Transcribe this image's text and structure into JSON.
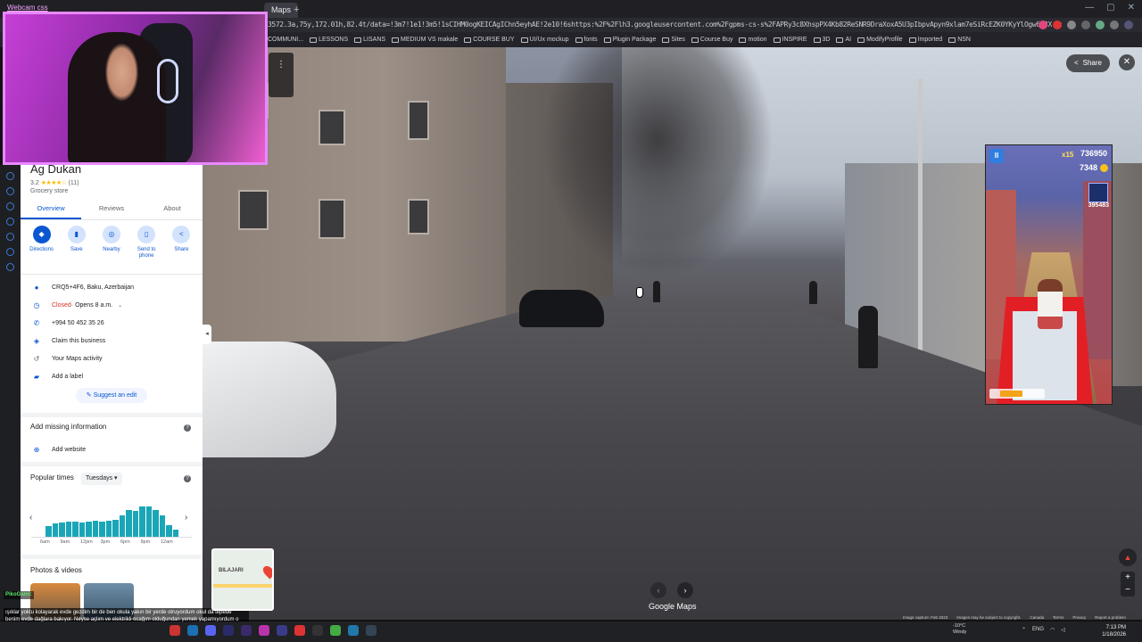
{
  "browser": {
    "tab_title": "Maps",
    "new_tab": "+",
    "window_controls": [
      "—",
      "▢",
      "✕"
    ],
    "url": "3572.3a,75y,172.01h,82.4t/data=!3m7!1e1!3m5!1sCIHM0ogKEICAgIChn5eyhAE!2e10!6shttps:%2F%2Flh3.googleusercontent.com%2Fgpms-cs-s%2FAPRy3c8XhspPX4Kb82ReSNR9DraXoxA5U3pIbpvApyn9xlam7eSiRcEZK0YKyYlOgw613X-yeMFKdW5xuyI0lFvkpnaLZ7QpQ2J1gMc6mN6",
    "bookmarks": [
      "COMMUNI...",
      "LESSONS",
      "LISANS",
      "MEDIUM VS makale",
      "COURSE BUY",
      "UI/Ux mockup",
      "fonts",
      "Plugin Package",
      "Sites",
      "Course Buy",
      "motion",
      "INSPIRE",
      "3D",
      "AI",
      "ModifyProfile",
      "Imported",
      "NSN"
    ]
  },
  "webcam": {
    "label": "Webcam css"
  },
  "place": {
    "name": "Ag Dukan",
    "rating": "3.2",
    "stars": "★★★★☆",
    "review_count": "(11)",
    "category": "Grocery store",
    "tabs": [
      "Overview",
      "Reviews",
      "About"
    ],
    "actions": [
      {
        "label": "Directions",
        "icon": "◆"
      },
      {
        "label": "Save",
        "icon": "▮"
      },
      {
        "label": "Nearby",
        "icon": "◎"
      },
      {
        "label": "Send to phone",
        "icon": "▯"
      },
      {
        "label": "Share",
        "icon": "<"
      }
    ],
    "address": "CRQ5+4F6, Baku, Azerbaijan",
    "status_closed": "Closed",
    "status_opens": " · Opens 8 a.m.",
    "phone": "+994 50 452 35 26",
    "claim": "Claim this business",
    "maps_activity": "Your Maps activity",
    "add_label": "Add a label",
    "suggest_edit": "Suggest an edit",
    "missing_title": "Add missing information",
    "add_website": "Add website",
    "popular_title": "Popular times",
    "popular_day": "Tuesdays",
    "hour_labels": [
      "6am",
      "9am",
      "12pm",
      "3pm",
      "6pm",
      "9pm",
      "12am"
    ],
    "photos_title": "Photos & videos"
  },
  "chart_data": {
    "type": "bar",
    "title": "Popular times",
    "categories": [
      "6am",
      "7am",
      "8am",
      "9am",
      "10am",
      "11am",
      "12pm",
      "1pm",
      "2pm",
      "3pm",
      "4pm",
      "5pm",
      "6pm",
      "7pm",
      "8pm",
      "9pm",
      "10pm",
      "11pm",
      "12am",
      "1am"
    ],
    "values": [
      28,
      35,
      38,
      40,
      40,
      38,
      40,
      43,
      40,
      43,
      45,
      55,
      70,
      68,
      80,
      78,
      70,
      55,
      30,
      18
    ],
    "ylim": [
      0,
      100
    ]
  },
  "streetview": {
    "share": "Share",
    "close": "✕",
    "menu": "⋮",
    "nav_prev": "‹",
    "nav_next": "›",
    "logo": "Google Maps",
    "compass": "▲",
    "zoom_in": "+",
    "zoom_out": "−",
    "footer": [
      "Image capture: Feb 2023",
      "Images may be subject to copyright.",
      "Canada",
      "Terms",
      "Privacy",
      "Report a problem"
    ]
  },
  "minimap": {
    "label": "BILAJARI"
  },
  "game": {
    "pause": "II",
    "multiplier": "x15",
    "score": "736950",
    "coins": "7348",
    "highscore_label": "HIGH SCORE",
    "highscore": "395483",
    "power_fill_percent": 55
  },
  "chat": {
    "user": "PikoGami:",
    "message": "ışıklar yoktu kolayarak evde gezdim bir de ben okula yakın bir yerde otruyordum okul da tepede benim evde dağlara bakıyor. Neyse açlım ve elektrikli ocağım olduğundan yemek yapamıyordum o yüzden aşağı erzak bulmaya çıktım"
  },
  "taskbar": {
    "weather_temp": "-10°C",
    "weather_cond": "Windy",
    "lang": "ENG",
    "time": "7:13 PM",
    "date": "1/18/2026"
  }
}
